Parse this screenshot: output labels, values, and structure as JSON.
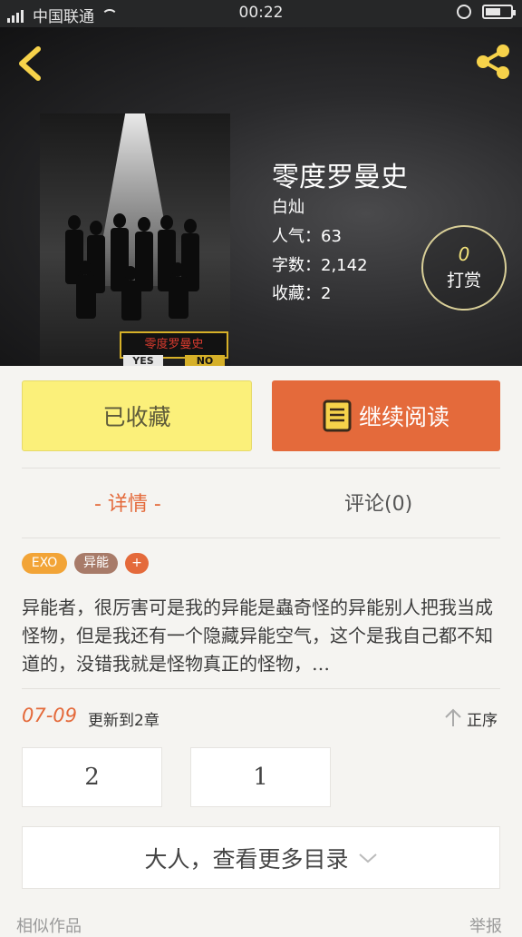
{
  "status_bar": {
    "carrier": "中国联通",
    "time": "00:22"
  },
  "book": {
    "title": "零度罗曼史",
    "author": "白灿",
    "popularity": "人气：63",
    "word_count": "字数：2,142",
    "favorites": "收藏：2",
    "cover_title": "零度罗曼史",
    "cover_yes": "YES",
    "cover_no": "NO"
  },
  "reward": {
    "count": "0",
    "label": "打赏"
  },
  "actions": {
    "favorited_label": "已收藏",
    "continue_label": "继续阅读"
  },
  "tabs": {
    "details": "- 详情 -",
    "comments": "评论(0)"
  },
  "tags": {
    "exo": "EXO",
    "power": "异能",
    "add": "+"
  },
  "synopsis": "异能者，很厉害可是我的异能是蟲奇怪的异能别人把我当成怪物，但是我还有一个隐藏异能空气，这个是我自己都不知道的，没错我就是怪物真正的怪物，…",
  "update": {
    "date": "07-09",
    "text": "更新到2章",
    "sort_label": "正序"
  },
  "chapters": [
    "2",
    "1"
  ],
  "more_catalog": "大人，查看更多目录",
  "footer": {
    "similar": "相似作品",
    "report": "举报"
  },
  "colors": {
    "accent": "#e46a3b",
    "favorite_bg": "#fbf07a",
    "icon_yellow": "#f6d24a"
  },
  "icons": [
    "back-icon",
    "share-icon",
    "book-icon",
    "sort-arrow-icon",
    "chevron-down-icon"
  ]
}
